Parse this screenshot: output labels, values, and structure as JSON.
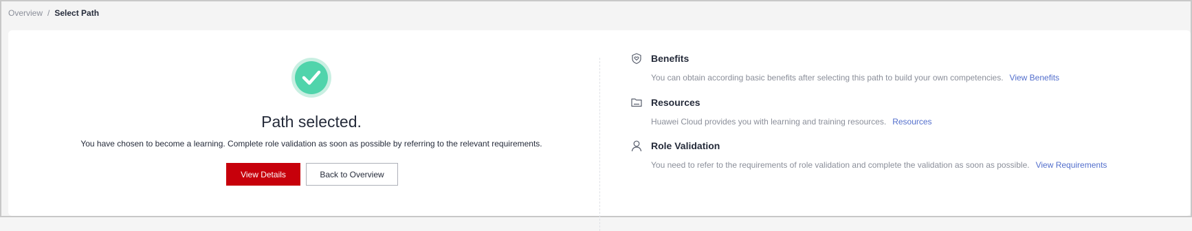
{
  "breadcrumb": {
    "parent": "Overview",
    "separator": "/",
    "current": "Select Path"
  },
  "result": {
    "icon": "check-circle-icon",
    "title": "Path selected.",
    "message": "You have chosen to become a learning. Complete role validation as soon as possible by referring to the relevant requirements.",
    "primary_button": "View Details",
    "secondary_button": "Back to Overview"
  },
  "info_items": [
    {
      "icon": "heart-badge-icon",
      "title": "Benefits",
      "description": "You can obtain according basic benefits after selecting this path to build your own competencies.",
      "link": "View Benefits"
    },
    {
      "icon": "folder-icon",
      "title": "Resources",
      "description": "Huawei Cloud provides you with learning and training resources.",
      "link": "Resources"
    },
    {
      "icon": "user-icon",
      "title": "Role Validation",
      "description": "You need to refer to the requirements of role validation and complete the validation as soon as possible.",
      "link": "View Requirements"
    }
  ],
  "colors": {
    "primary": "#c7000b",
    "success": "#50d4ab",
    "link": "#526ecc"
  }
}
